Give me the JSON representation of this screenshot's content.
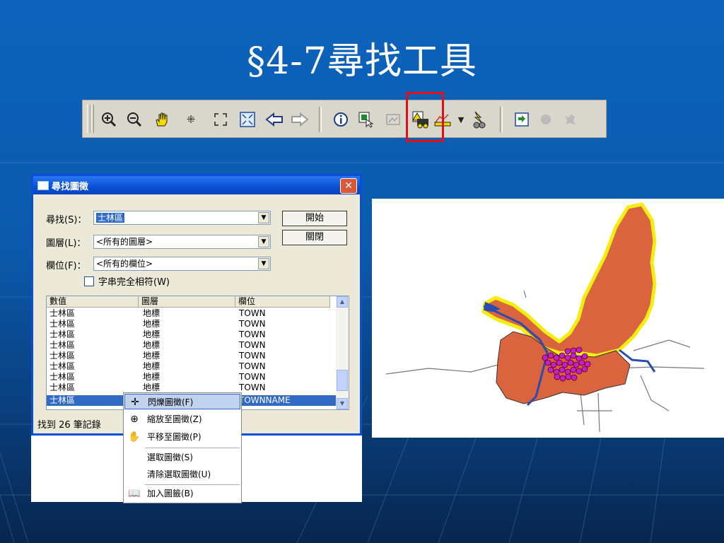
{
  "slide": {
    "title": "§4-7尋找工具"
  },
  "toolbar": {
    "buttons": [
      {
        "icon": "zoom-in-icon"
      },
      {
        "icon": "zoom-out-icon"
      },
      {
        "icon": "pan-hand-icon"
      },
      {
        "icon": "fixed-zoom-in-icon"
      },
      {
        "icon": "fixed-zoom-out-icon"
      },
      {
        "icon": "full-extent-icon"
      },
      {
        "icon": "back-arrow-icon"
      },
      {
        "icon": "forward-arrow-icon"
      },
      {
        "icon": "identify-icon"
      },
      {
        "icon": "select-features-icon"
      },
      {
        "icon": "select-elements-icon"
      },
      {
        "icon": "find-icon",
        "highlighted": true
      },
      {
        "icon": "measure-icon"
      },
      {
        "icon": "hyperlink-icon"
      },
      {
        "icon": "editor-icon"
      },
      {
        "icon": "dot-icon"
      },
      {
        "icon": "pin-icon"
      }
    ],
    "highlight_color": "#e0101a"
  },
  "dialog": {
    "title": "尋找圖徵",
    "find_label": "尋找(S)：",
    "find_value": "士林區",
    "layer_label": "圖層(L)：",
    "layer_value": "<所有的圖層>",
    "field_label": "欄位(F)：",
    "field_value": "<所有的欄位>",
    "match_whole": "字串完全相符(W)",
    "start_button": "開始",
    "close_button": "關閉",
    "columns": [
      "數值",
      "圖層",
      "欄位"
    ],
    "rows": [
      [
        "士林區",
        "地標",
        "TOWN"
      ],
      [
        "士林區",
        "地標",
        "TOWN"
      ],
      [
        "士林區",
        "地標",
        "TOWN"
      ],
      [
        "士林區",
        "地標",
        "TOWN"
      ],
      [
        "士林區",
        "地標",
        "TOWN"
      ],
      [
        "士林區",
        "地標",
        "TOWN"
      ],
      [
        "士林區",
        "地標",
        "TOWN"
      ],
      [
        "士林區",
        "地標",
        "TOWN"
      ]
    ],
    "selected_row": [
      "士林區",
      "",
      "TOWNNAME"
    ],
    "status": "找到 26 筆記錄"
  },
  "context_menu": {
    "items": [
      {
        "label": "閃爍圖徵(F)",
        "icon": "flash-icon"
      },
      {
        "label": "縮放至圖徵(Z)",
        "icon": "zoom-to-icon"
      },
      {
        "label": "平移至圖徵(P)",
        "icon": "pan-icon"
      },
      {
        "label": "選取圖徵(S)",
        "icon": ""
      },
      {
        "label": "清除選取圖徵(U)",
        "icon": ""
      },
      {
        "label": "加入圖籤(B)",
        "icon": "bookmark-icon"
      }
    ]
  },
  "map": {
    "district_color": "#d9643d",
    "highlight_outline_color": "#f2ee10",
    "points_color": "#c020d0",
    "river_color": "#2a4cae"
  }
}
